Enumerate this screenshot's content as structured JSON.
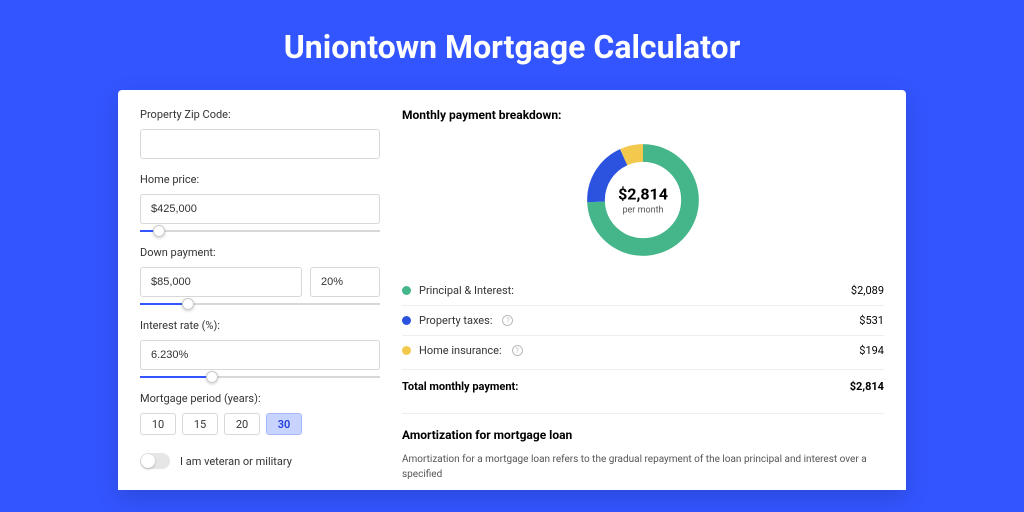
{
  "title": "Uniontown Mortgage Calculator",
  "form": {
    "zip_label": "Property Zip Code:",
    "zip_value": "",
    "price_label": "Home price:",
    "price_value": "$425,000",
    "price_slider_pct": 8,
    "down_label": "Down payment:",
    "down_value": "$85,000",
    "down_pct": "20%",
    "down_slider_pct": 20,
    "rate_label": "Interest rate (%):",
    "rate_value": "6.230%",
    "rate_slider_pct": 30,
    "period_label": "Mortgage period (years):",
    "period_options": [
      "10",
      "15",
      "20",
      "30"
    ],
    "period_selected": "30",
    "veteran_label": "I am veteran or military"
  },
  "breakdown": {
    "title": "Monthly payment breakdown:",
    "center_value": "$2,814",
    "center_sub": "per month",
    "items": [
      {
        "label": "Principal & Interest:",
        "amount": "$2,089",
        "color": "#45b58a"
      },
      {
        "label": "Property taxes:",
        "amount": "$531",
        "color": "#2c52e0",
        "info": true
      },
      {
        "label": "Home insurance:",
        "amount": "$194",
        "color": "#f2c94c",
        "info": true
      }
    ],
    "total_label": "Total monthly payment:",
    "total_amount": "$2,814"
  },
  "chart_data": {
    "type": "pie",
    "title": "Monthly payment breakdown",
    "categories": [
      "Principal & Interest",
      "Property taxes",
      "Home insurance"
    ],
    "values": [
      2089,
      531,
      194
    ],
    "colors": [
      "#45b58a",
      "#2c52e0",
      "#f2c94c"
    ],
    "total": 2814
  },
  "amortization": {
    "title": "Amortization for mortgage loan",
    "text": "Amortization for a mortgage loan refers to the gradual repayment of the loan principal and interest over a specified"
  }
}
